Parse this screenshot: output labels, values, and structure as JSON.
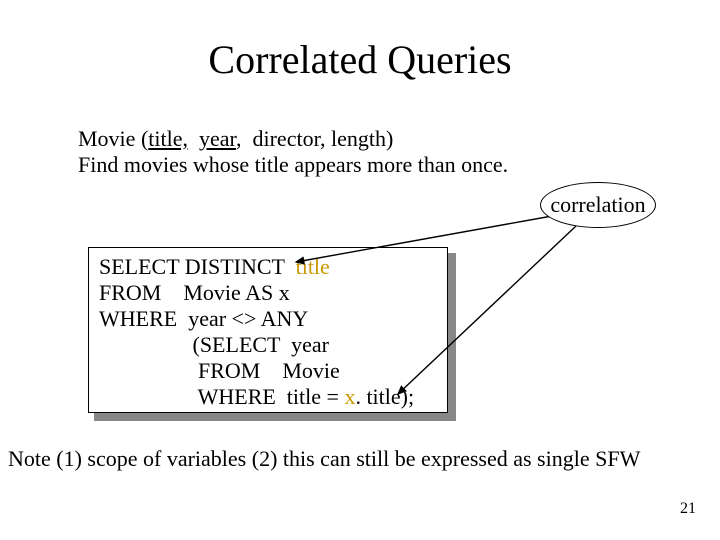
{
  "title": "Correlated Queries",
  "schema": {
    "relation": "Movie",
    "attr_title": "title,",
    "attr_year": "year",
    "attr_rest": ",  director, length)"
  },
  "task": "Find movies whose title appears more than once.",
  "correlation_label": "correlation",
  "sql": {
    "l1a": "SELECT DISTINCT  ",
    "l1b": "title",
    "l2": "FROM    Movie AS x",
    "l3": "WHERE  year <> ANY",
    "l4": "                 (SELECT  year",
    "l5": "                  FROM    Movie",
    "l6a": "                  WHERE  title = ",
    "l6b": "x",
    "l6c": ". title);"
  },
  "footnote": "Note (1) scope of variables (2) this can still be expressed as single SFW",
  "page_number": "21"
}
